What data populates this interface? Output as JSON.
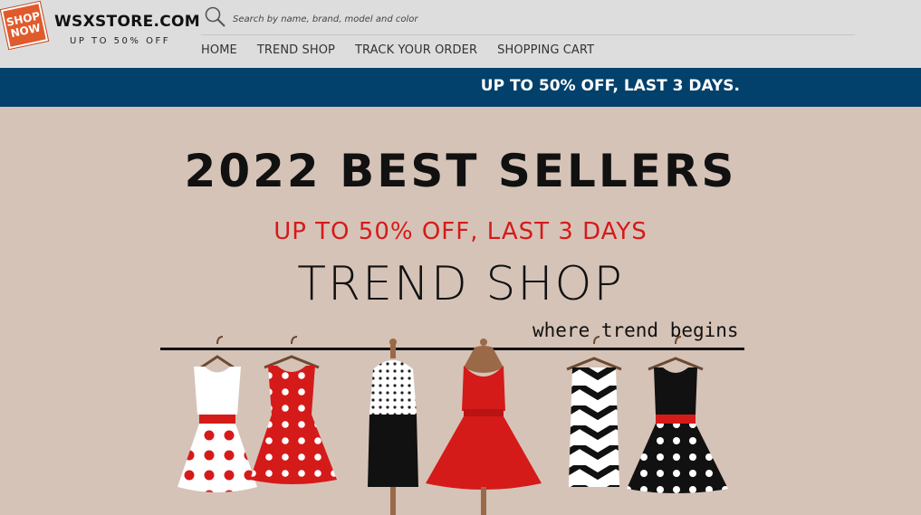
{
  "logo": {
    "badge_text": "SHOP NOW",
    "name": "WSXSTORE.COM",
    "tagline": "UP TO 50% OFF"
  },
  "search": {
    "placeholder": "Search by name, brand, model and color",
    "icon": "search-icon"
  },
  "nav": {
    "items": [
      "HOME",
      "TREND SHOP",
      "TRACK YOUR ORDER",
      "SHOPPING CART"
    ]
  },
  "promo_bar": {
    "text": "UP TO 50% OFF, LAST 3 DAYS."
  },
  "hero": {
    "title": "2022 BEST SELLERS",
    "subtitle": "UP TO 50% OFF, LAST 3 DAYS",
    "shop_name": "TREND SHOP",
    "tagline": "where trend begins"
  },
  "colors": {
    "header_bg": "#dddddd",
    "promo_bg": "#02416b",
    "hero_bg": "#d6c3b7",
    "accent_red": "#d51a1a"
  }
}
